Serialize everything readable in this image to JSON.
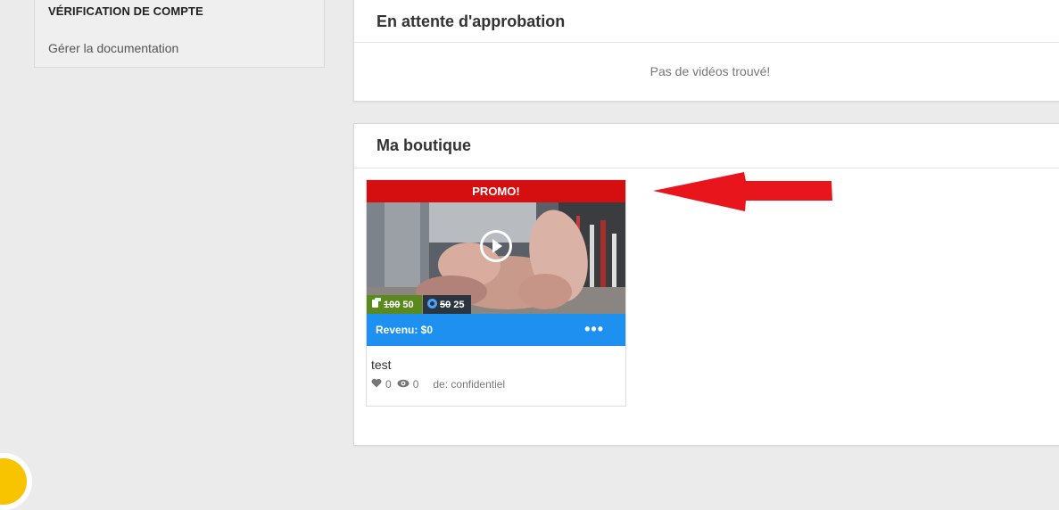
{
  "sidebar": {
    "section_title": "VÉRIFICATION DE COMPTE",
    "link_label": "Gérer la documentation"
  },
  "pending": {
    "title": "En attente d'approbation",
    "empty_message": "Pas de vidéos trouvé!"
  },
  "shop": {
    "title": "Ma boutique",
    "card": {
      "badge": "PROMO!",
      "price_tokens_old": "100",
      "price_tokens_new": "50",
      "price_points_old": "50",
      "price_points_new": "25",
      "revenue": "Revenu: $0",
      "more": "•••",
      "title": "test",
      "likes": "0",
      "views": "0",
      "author": "de: confidentiel"
    }
  },
  "colors": {
    "promo": "#d50f0f",
    "revenue_bar": "#1e90f0",
    "arrow": "#e8151c",
    "price_tokens": "#5a8a1d",
    "price_points": "#2b3540"
  },
  "icons": {
    "tokens": "coins-icon",
    "points": "star-badge-icon",
    "play": "play-icon",
    "like": "heart-icon",
    "views": "eye-icon",
    "annotation": "arrow-left-icon"
  }
}
